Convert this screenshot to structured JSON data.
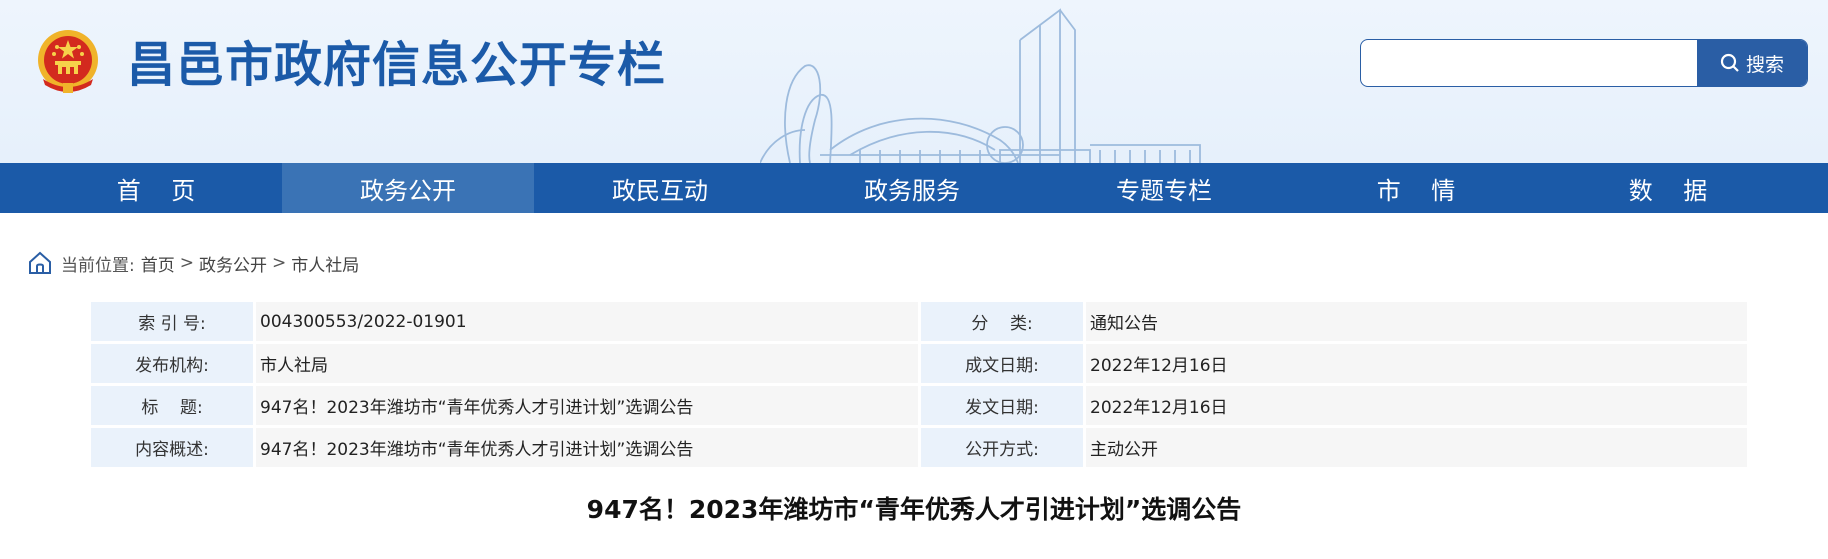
{
  "header": {
    "site_title": "昌邑市政府信息公开专栏",
    "search": {
      "placeholder": "",
      "button_label": "搜索"
    }
  },
  "nav": {
    "items": [
      {
        "label": "首    页"
      },
      {
        "label": "政务公开",
        "active": true
      },
      {
        "label": "政民互动"
      },
      {
        "label": "政务服务"
      },
      {
        "label": "专题专栏"
      },
      {
        "label": "市    情"
      },
      {
        "label": "数    据"
      }
    ]
  },
  "breadcrumb": {
    "prefix": "当前位置:",
    "items": [
      "首页",
      "政务公开",
      "市人社局"
    ],
    "separator": ">"
  },
  "meta": {
    "rows": [
      {
        "l1": "索 引 号:",
        "v1": "004300553/2022-01901",
        "l2": "分    类:",
        "v2": "通知公告"
      },
      {
        "l1": "发布机构:",
        "v1": "市人社局",
        "l2": "成文日期:",
        "v2": "2022年12月16日"
      },
      {
        "l1": "标    题:",
        "v1": "947名！2023年潍坊市“青年优秀人才引进计划”选调公告",
        "l2": "发文日期:",
        "v2": "2022年12月16日"
      },
      {
        "l1": "内容概述:",
        "v1": "947名！2023年潍坊市“青年优秀人才引进计划”选调公告",
        "l2": "公开方式:",
        "v2": "主动公开"
      }
    ]
  },
  "article": {
    "title": "947名！2023年潍坊市“青年优秀人才引进计划”选调公告"
  },
  "colors": {
    "brand_blue": "#1b5aa8",
    "nav_active": "#3a73b5",
    "header_bg": "#eef5fd",
    "label_bg": "#eaf2fb",
    "value_bg": "#f6f6f6"
  },
  "icons": {
    "emblem": "national-emblem-icon",
    "search": "search-icon",
    "home": "home-icon"
  }
}
